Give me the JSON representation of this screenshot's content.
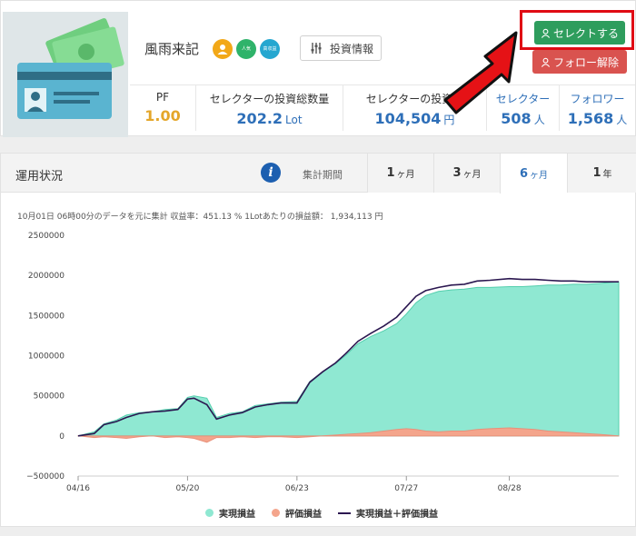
{
  "profile": {
    "name": "風雨来記",
    "badges": [
      {
        "icon": "user-icon",
        "label": ""
      },
      {
        "icon": "popular-badge-icon",
        "label": "人気"
      },
      {
        "icon": "profit-badge-icon",
        "label": "高収益"
      }
    ],
    "info_button": "投資情報",
    "select_button": "セレクトする",
    "unfollow_button": "フォロー解除",
    "stats": [
      {
        "label": "PF",
        "value": "1.00",
        "unit": ""
      },
      {
        "label": "セレクターの投資総数量",
        "value": "202.2",
        "unit": "Lot"
      },
      {
        "label": "セレクターの投資総",
        "value": "104,504",
        "unit": "円"
      },
      {
        "label": "セレクター",
        "value": "508",
        "unit": "人"
      },
      {
        "label": "フォロワー",
        "value": "1,568",
        "unit": "人"
      }
    ]
  },
  "performance": {
    "title": "運用状況",
    "period_label": "集計期間",
    "tabs": [
      {
        "main": "1",
        "sub": "ヶ月"
      },
      {
        "main": "3",
        "sub": "ヶ月"
      },
      {
        "main": "6",
        "sub": "ヶ月"
      },
      {
        "main": "1",
        "sub": "年"
      }
    ],
    "active_tab": 2,
    "note": "10月01日 06時00分のデータを元に集計 収益率：451.13 % 1Lotあたりの損益額： 1,934,113 円"
  },
  "colors": {
    "realized": "#8fe8d2",
    "realized_edge": "#55cfae",
    "unrealized": "#f4a58c",
    "total_line": "#2b1750",
    "select_green": "#2e9d5d",
    "unfollow_red": "#d9534f",
    "highlight_red": "#e00b14",
    "accent_blue": "#2e6fb8"
  },
  "chart_data": {
    "type": "area",
    "x_ticks": [
      "04/16",
      "05/20",
      "06/23",
      "07/27",
      "08/28"
    ],
    "ylim": [
      -500000,
      2500000
    ],
    "y_ticks": [
      2500000,
      2000000,
      1500000,
      1000000,
      500000,
      0,
      -500000
    ],
    "y_tick_labels": [
      "2500000",
      "2000000",
      "1500000",
      "1000000",
      "500000",
      "0",
      "−500000"
    ],
    "grid": false,
    "legend_position": "bottom",
    "x_range": [
      "04/16",
      "10/01"
    ],
    "x": [
      "04/16",
      "04/21",
      "04/24",
      "04/28",
      "05/01",
      "05/05",
      "05/09",
      "05/13",
      "05/17",
      "05/20",
      "05/22",
      "05/26",
      "05/29",
      "06/02",
      "06/06",
      "06/10",
      "06/14",
      "06/18",
      "06/23",
      "06/27",
      "07/01",
      "07/05",
      "07/08",
      "07/12",
      "07/16",
      "07/20",
      "07/24",
      "07/27",
      "07/30",
      "08/02",
      "08/06",
      "08/10",
      "08/14",
      "08/18",
      "08/22",
      "08/28",
      "09/01",
      "09/05",
      "09/09",
      "09/13",
      "09/17",
      "09/21",
      "09/25",
      "10/01"
    ],
    "series": [
      {
        "name": "実現損益",
        "values": [
          0,
          50000,
          150000,
          200000,
          260000,
          290000,
          300000,
          330000,
          340000,
          480000,
          500000,
          470000,
          230000,
          280000,
          300000,
          380000,
          400000,
          420000,
          430000,
          680000,
          800000,
          900000,
          1000000,
          1150000,
          1240000,
          1310000,
          1400000,
          1520000,
          1660000,
          1750000,
          1800000,
          1820000,
          1830000,
          1850000,
          1850000,
          1860000,
          1860000,
          1870000,
          1880000,
          1880000,
          1890000,
          1890000,
          1900000,
          1920000
        ]
      },
      {
        "name": "評価損益",
        "values": [
          0,
          -20000,
          -10000,
          -20000,
          -30000,
          -10000,
          0,
          -20000,
          -10000,
          -20000,
          -30000,
          -80000,
          -20000,
          -20000,
          -10000,
          -20000,
          -10000,
          -10000,
          -20000,
          -10000,
          0,
          10000,
          20000,
          30000,
          40000,
          60000,
          80000,
          90000,
          80000,
          60000,
          50000,
          60000,
          60000,
          80000,
          90000,
          100000,
          90000,
          80000,
          60000,
          50000,
          40000,
          30000,
          20000,
          0
        ]
      },
      {
        "name": "実現損益＋評価損益",
        "values": [
          0,
          30000,
          140000,
          180000,
          230000,
          280000,
          300000,
          310000,
          330000,
          460000,
          470000,
          390000,
          210000,
          260000,
          290000,
          360000,
          390000,
          410000,
          410000,
          670000,
          800000,
          910000,
          1020000,
          1180000,
          1280000,
          1370000,
          1480000,
          1610000,
          1740000,
          1810000,
          1850000,
          1880000,
          1890000,
          1930000,
          1940000,
          1960000,
          1950000,
          1950000,
          1940000,
          1930000,
          1930000,
          1920000,
          1920000,
          1920000
        ]
      }
    ]
  },
  "legend": [
    "実現損益",
    "評価損益",
    "実現損益＋評価損益"
  ]
}
